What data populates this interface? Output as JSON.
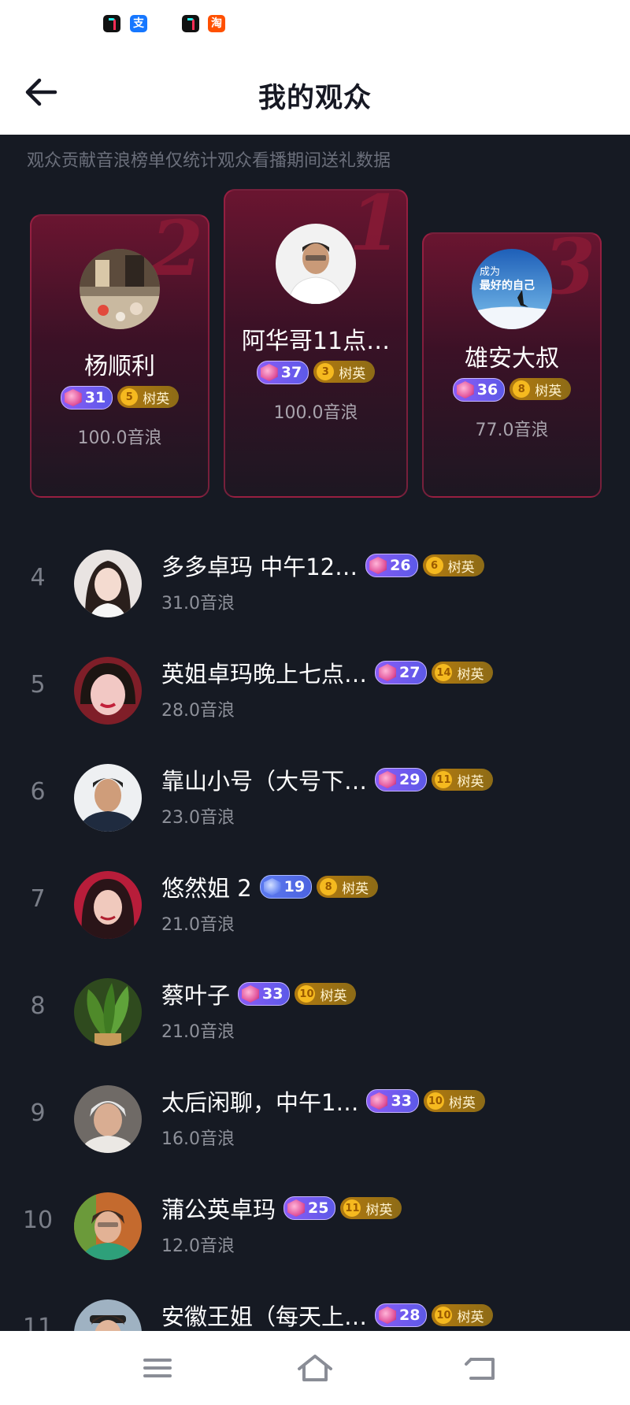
{
  "status_bar": {
    "icons": [
      "tiktok-icon",
      "alipay-icon",
      "tiktok-lite-icon",
      "taobao-icon"
    ],
    "alipay_glyph": "支",
    "taobao_glyph": "淘"
  },
  "header": {
    "title": "我的观众"
  },
  "notice": "观众贡献音浪榜单仅统计观众看播期间送礼数据",
  "podium": [
    {
      "rank": "2",
      "name": "杨顺利",
      "level": "31",
      "fan_level": "5",
      "fan_label": "树英",
      "value": "100.0音浪"
    },
    {
      "rank": "1",
      "name": "阿华哥11点…",
      "level": "37",
      "fan_level": "3",
      "fan_label": "树英",
      "value": "100.0音浪"
    },
    {
      "rank": "3",
      "name": "雄安大叔",
      "level": "36",
      "fan_level": "8",
      "fan_label": "树英",
      "value": "77.0音浪",
      "avatar_text_top": "成为",
      "avatar_text_bottom": "最好的自己"
    }
  ],
  "list": [
    {
      "rank": "4",
      "name": "多多卓玛 中午12…",
      "level": "26",
      "fan_level": "6",
      "fan_label": "树英",
      "value": "31.0音浪"
    },
    {
      "rank": "5",
      "name": "英姐卓玛晚上七点…",
      "level": "27",
      "fan_level": "14",
      "fan_label": "树英",
      "value": "28.0音浪"
    },
    {
      "rank": "6",
      "name": "靠山小号（大号下…",
      "level": "29",
      "fan_level": "11",
      "fan_label": "树英",
      "value": "23.0音浪"
    },
    {
      "rank": "7",
      "name": "悠然姐 2",
      "level": "19",
      "fan_level": "8",
      "fan_label": "树英",
      "value": "21.0音浪"
    },
    {
      "rank": "8",
      "name": "蔡叶子",
      "level": "33",
      "fan_level": "10",
      "fan_label": "树英",
      "value": "21.0音浪"
    },
    {
      "rank": "9",
      "name": "太后闲聊，中午1…",
      "level": "33",
      "fan_level": "10",
      "fan_label": "树英",
      "value": "16.0音浪"
    },
    {
      "rank": "10",
      "name": "蒲公英卓玛",
      "level": "25",
      "fan_level": "11",
      "fan_label": "树英",
      "value": "12.0音浪"
    },
    {
      "rank": "11",
      "name": "安徽王姐（每天上…",
      "level": "28",
      "fan_level": "10",
      "fan_label": "树英",
      "value": ""
    }
  ],
  "bottom_nav": [
    "menu-icon",
    "home-icon",
    "back-icon"
  ],
  "colors": {
    "background": "#161a23",
    "podium_card": "#3b1126",
    "level_badge": "#7a5cf0",
    "fan_badge": "#a8760f"
  }
}
